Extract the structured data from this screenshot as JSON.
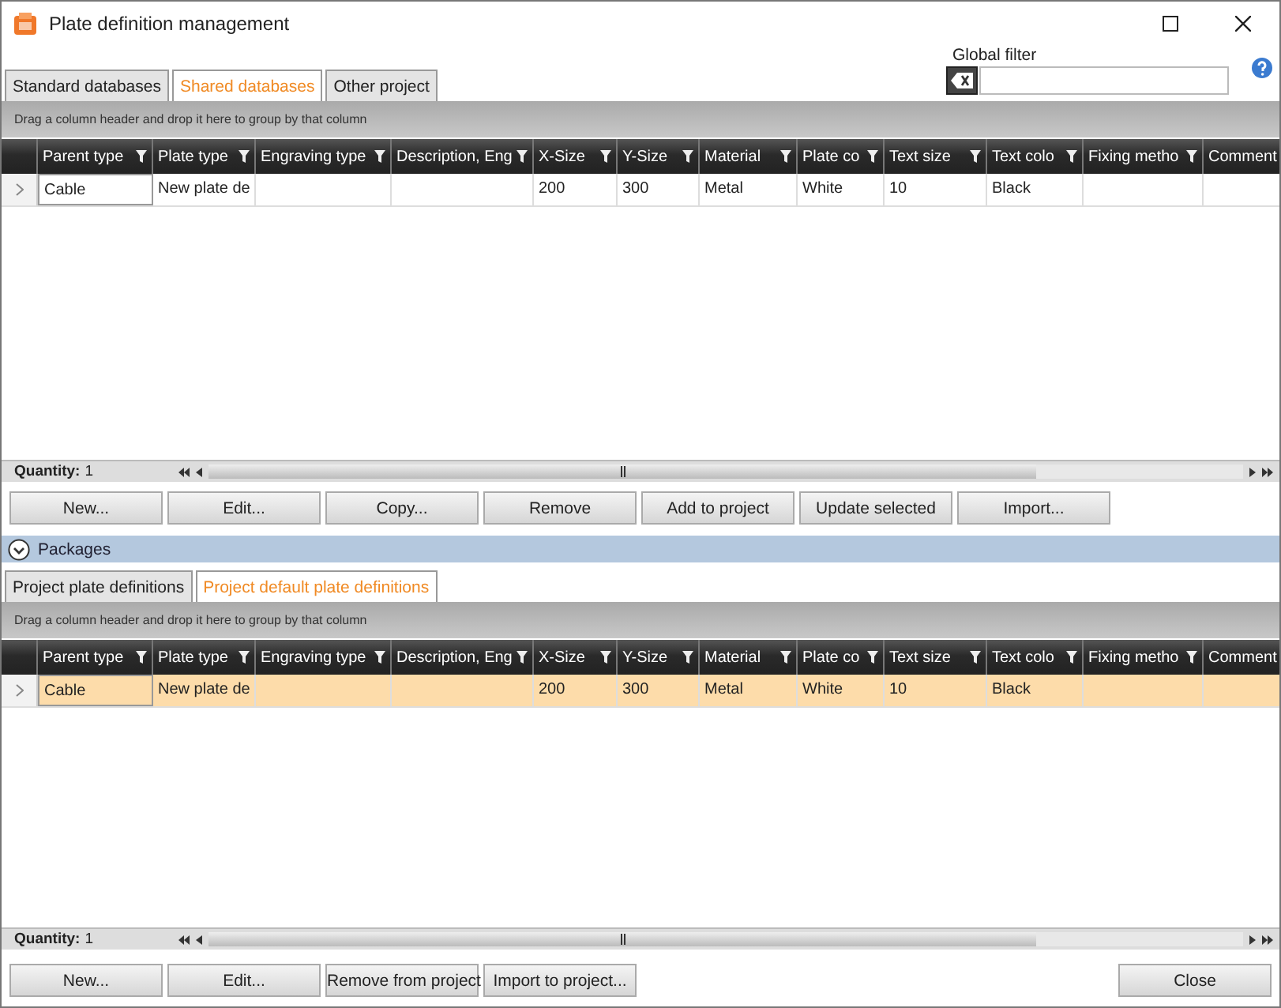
{
  "window": {
    "title": "Plate definition management"
  },
  "tabs": [
    {
      "label": "Standard databases",
      "selected": false
    },
    {
      "label": "Shared databases",
      "selected": true
    },
    {
      "label": "Other project",
      "selected": false
    }
  ],
  "global_filter": {
    "label": "Global filter"
  },
  "main_grid": {
    "group_hint": "Drag a column header and drop it here to group by that column",
    "columns": [
      "Parent type",
      "Plate type",
      "Engraving type",
      "Description, Eng",
      "X-Size",
      "Y-Size",
      "Material",
      "Plate co",
      "Text size",
      "Text colo",
      "Fixing metho",
      "Comment"
    ],
    "rows": [
      {
        "selected": false,
        "cells": [
          "Cable",
          "New plate de",
          "",
          "",
          "200",
          "300",
          "Metal",
          "White",
          "10",
          "Black",
          "",
          ""
        ]
      }
    ],
    "quantity_label": "Quantity:",
    "quantity": "1"
  },
  "buttons": [
    "New...",
    "Edit...",
    "Copy...",
    "Remove",
    "Add to project",
    "Update selected",
    "Import..."
  ],
  "packages": {
    "label": "Packages"
  },
  "package_tabs": [
    {
      "label": "Project plate definitions",
      "selected": false
    },
    {
      "label": "Project default plate definitions",
      "selected": true
    }
  ],
  "package_grid": {
    "group_hint": "Drag a column header and drop it here to group by that column",
    "columns": [
      "Parent type",
      "Plate type",
      "Engraving type",
      "Description, Eng",
      "X-Size",
      "Y-Size",
      "Material",
      "Plate co",
      "Text size",
      "Text colo",
      "Fixing metho",
      "Comment"
    ],
    "rows": [
      {
        "selected": true,
        "cells": [
          "Cable",
          "New plate de",
          "",
          "",
          "200",
          "300",
          "Metal",
          "White",
          "10",
          "Black",
          "",
          ""
        ]
      }
    ],
    "quantity_label": "Quantity:",
    "quantity": "1"
  },
  "package_buttons": [
    "New...",
    "Edit...",
    "Remove from project",
    "Import to project..."
  ],
  "close_button": "Close"
}
